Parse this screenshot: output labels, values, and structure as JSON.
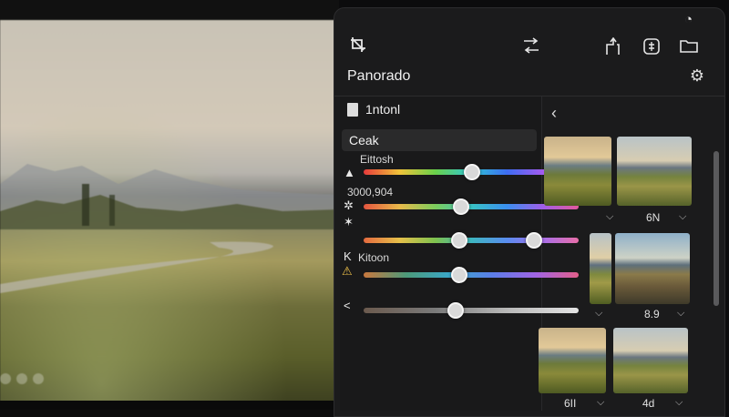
{
  "toolbar": {
    "icons": [
      "crop-tool-icon",
      "transform-icon",
      "export-icon",
      "gallery-icon",
      "folder-icon",
      "timer-icon"
    ]
  },
  "panel": {
    "title": "Panorado",
    "section_label": "1ntonl",
    "selected_item": "Ceak",
    "sliders": [
      {
        "label": "Eittosh",
        "symbol": "▲",
        "value": 0.45
      },
      {
        "label": "3000,904",
        "symbol": "✲",
        "value": 0.4
      },
      {
        "label": "",
        "symbol": "✶",
        "value_a": 0.45,
        "value_b": 0.8
      },
      {
        "label": "Kitoon",
        "symbol": "K",
        "warn_symbol": "⚠",
        "value": 0.44
      },
      {
        "label": "",
        "symbol": "<",
        "value": 0.42
      }
    ]
  },
  "thumbnails": [
    {
      "caption": ""
    },
    {
      "caption": "6N"
    },
    {
      "caption": ""
    },
    {
      "caption": "8.9"
    },
    {
      "caption": "6II"
    },
    {
      "caption": "4d"
    }
  ],
  "colors": {
    "panel_bg": "#1b1b1c",
    "accent_text": "#e8e8e8"
  }
}
